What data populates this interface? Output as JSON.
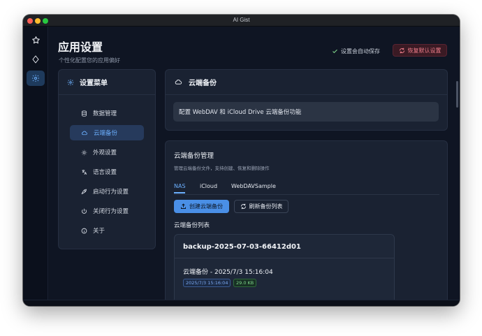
{
  "window": {
    "title": "AI Gist"
  },
  "rail": {
    "icons": [
      "star-icon",
      "tag-icon",
      "gear-icon"
    ],
    "active": "gear-icon"
  },
  "header": {
    "title": "应用设置",
    "subtitle": "个性化配置您的应用偏好",
    "autosave": "设置会自动保存",
    "reset_label": "恢复默认设置"
  },
  "menu": {
    "title": "设置菜单",
    "items": [
      {
        "label": "数据管理",
        "icon": "database-icon"
      },
      {
        "label": "云端备份",
        "icon": "cloud-icon",
        "active": true
      },
      {
        "label": "外观设置",
        "icon": "sun-icon"
      },
      {
        "label": "语言设置",
        "icon": "translate-icon"
      },
      {
        "label": "启动行为设置",
        "icon": "rocket-icon"
      },
      {
        "label": "关闭行为设置",
        "icon": "power-icon"
      },
      {
        "label": "关于",
        "icon": "info-icon"
      }
    ]
  },
  "cloud": {
    "title": "云端备份",
    "description": "配置 WebDAV 和 iCloud Drive 云端备份功能"
  },
  "manage": {
    "title": "云端备份管理",
    "subtitle": "管理云端备份文件，支持创建、恢复和删除操作",
    "tabs": [
      "NAS",
      "iCloud",
      "WebDAVSample"
    ],
    "active_tab": "NAS",
    "create_label": "创建云端备份",
    "refresh_label": "刷新备份列表",
    "list_label": "云端备份列表",
    "backup": {
      "name": "backup-2025-07-03-66412d01",
      "description": "云端备份 - 2025/7/3 15:16:04",
      "date": "2025/7/3 15:16:04",
      "size": "29.0 KB"
    }
  },
  "colors": {
    "accent": "#6cb0ff",
    "primary_button": "#4a8fe6",
    "danger": "#f07d8a",
    "success": "#7fd38a"
  }
}
